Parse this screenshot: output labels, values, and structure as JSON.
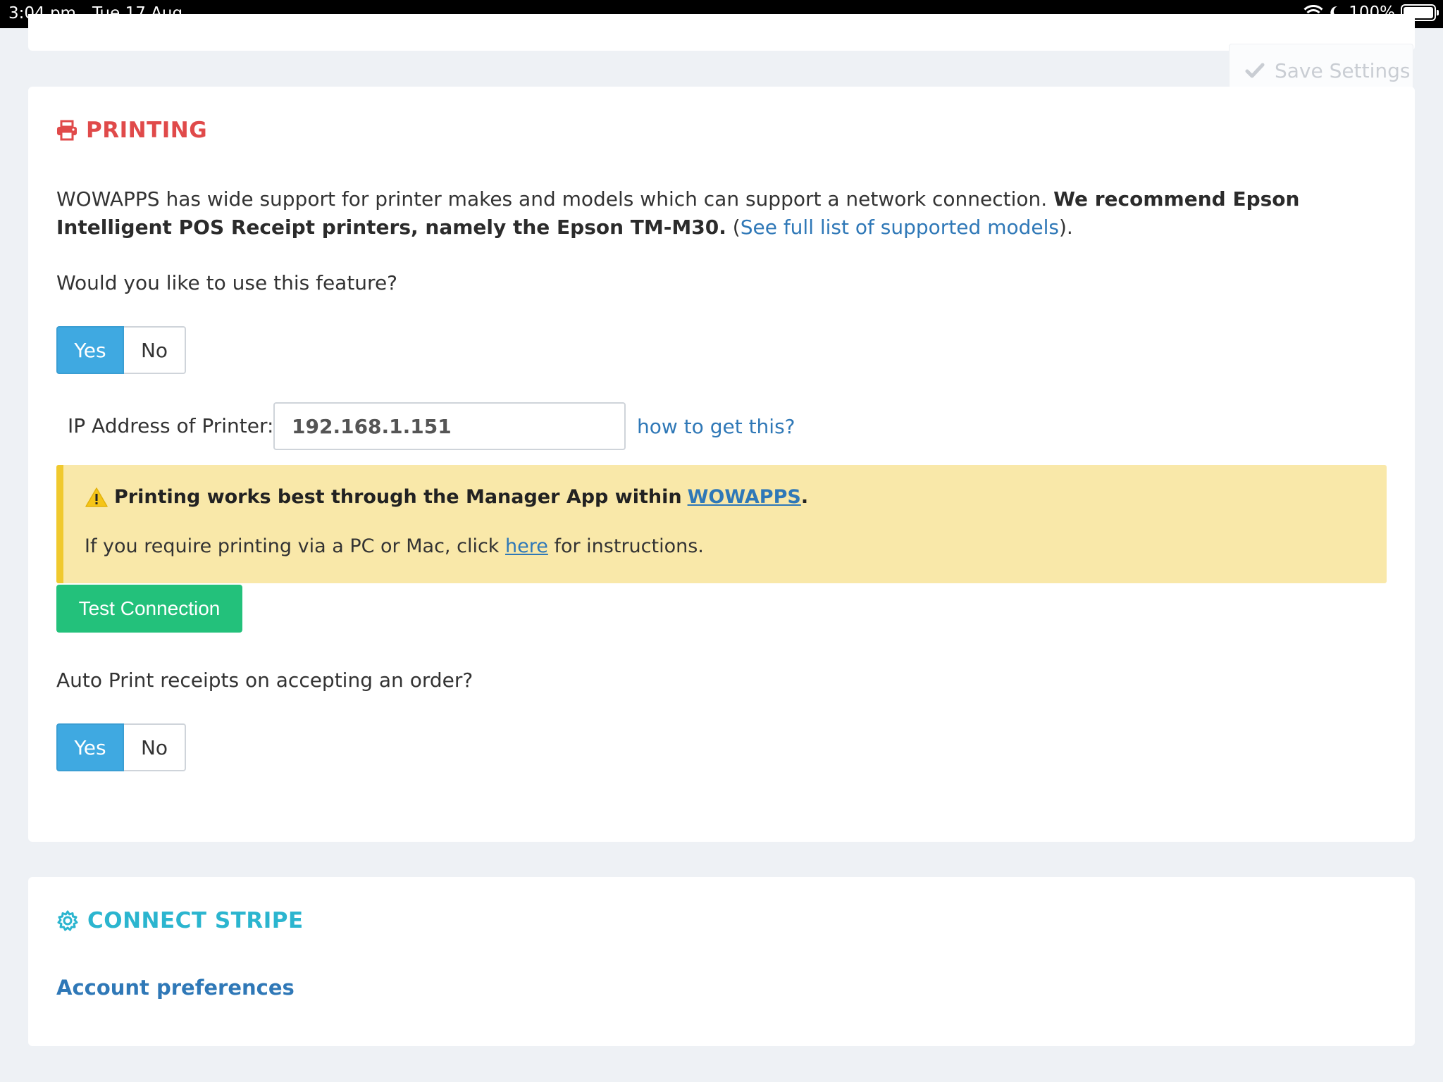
{
  "status_bar": {
    "time": "3:04 pm",
    "date": "Tue 17 Aug",
    "battery": "100%"
  },
  "toolbar": {
    "save_label": "Save Settings"
  },
  "printing": {
    "title": "PRINTING",
    "intro_text": "WOWAPPS has wide support for printer makes and models which can support a network connection.",
    "intro_bold": "We recommend Epson Intelligent POS Receipt printers, namely the Epson TM-M30.",
    "intro_paren_open": "(",
    "models_link": "See full list of supported models",
    "intro_paren_close": ").",
    "use_feature_question": "Would you like to use this feature?",
    "use_feature_yes": "Yes",
    "use_feature_no": "No",
    "use_feature_selected": "Yes",
    "ip_label": "IP Address of Printer:",
    "ip_value": "192.168.1.151",
    "how_link": "how to get this?",
    "alert": {
      "line1_text": "Printing works best through the Manager App within",
      "line1_link": "WOWAPPS",
      "line1_end": ".",
      "line2_start": "If you require printing via a PC or Mac, click",
      "line2_link": "here",
      "line2_end": "for instructions."
    },
    "test_button": "Test Connection",
    "auto_print_question": "Auto Print receipts on accepting an order?",
    "auto_print_yes": "Yes",
    "auto_print_no": "No",
    "auto_print_selected": "Yes"
  },
  "stripe": {
    "title": "CONNECT STRIPE",
    "account_link": "Account preferences"
  },
  "colors": {
    "printing_title": "#e04a4a",
    "stripe_title": "#2bb5cf",
    "toggle_active": "#3fa9e1",
    "test_button": "#23c17b",
    "alert_bg": "#f9e8a9",
    "link": "#2f78b7"
  },
  "icons": {
    "printing": "printer-icon",
    "stripe": "gear-icon",
    "save": "checkmark-icon",
    "alert": "warning-icon"
  }
}
